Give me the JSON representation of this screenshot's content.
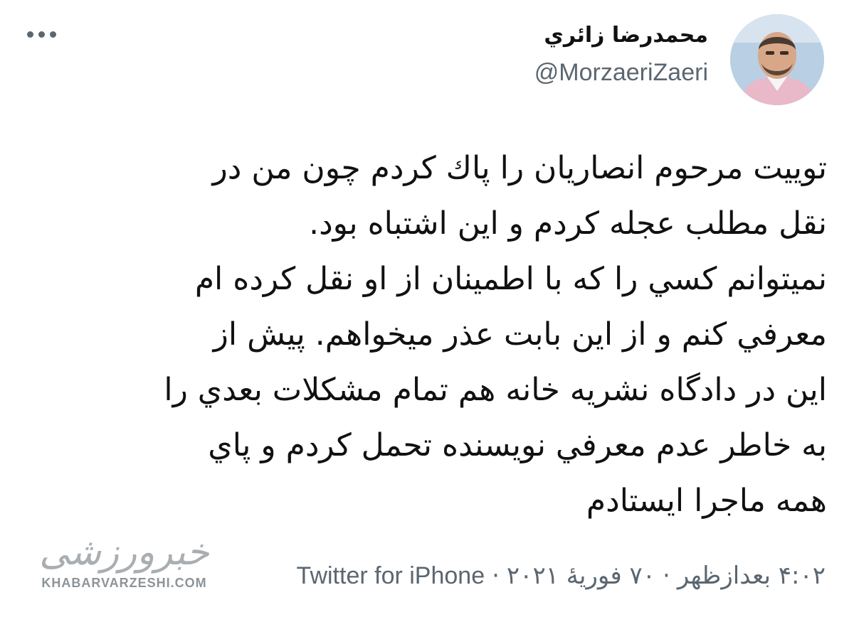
{
  "author": {
    "display_name": "محمدرضا زائري",
    "handle": "@MorzaeriZaeri"
  },
  "tweet": {
    "lines": [
      "توييت مرحوم انصاريان را پاك كردم چون من در",
      "نقل مطلب عجله كردم و اين اشتباه بود.",
      "نميتوانم كسي را كه با اطمينان از او نقل كرده ام",
      "معرفي كنم و از اين بابت عذر ميخواهم. پيش از",
      "اين در دادگاه نشريه خانه هم تمام مشكلات بعدي را",
      "به خاطر عدم معرفي نويسنده تحمل كردم و پاي",
      "همه ماجرا ايستادم"
    ]
  },
  "meta": {
    "time": "۴:۰۲ بعدازظهر",
    "separator": "·",
    "date": "۷۰ فوریهٔ ۲۰۲۱",
    "source": "Twitter for iPhone"
  },
  "watermark": {
    "logo_text": "خبرورزشی",
    "site": "KHABARVARZESHI.COM"
  },
  "icons": {
    "more": "more-horizontal-icon"
  },
  "colors": {
    "text": "#111111",
    "secondary": "#5b6670",
    "background": "#ffffff"
  }
}
